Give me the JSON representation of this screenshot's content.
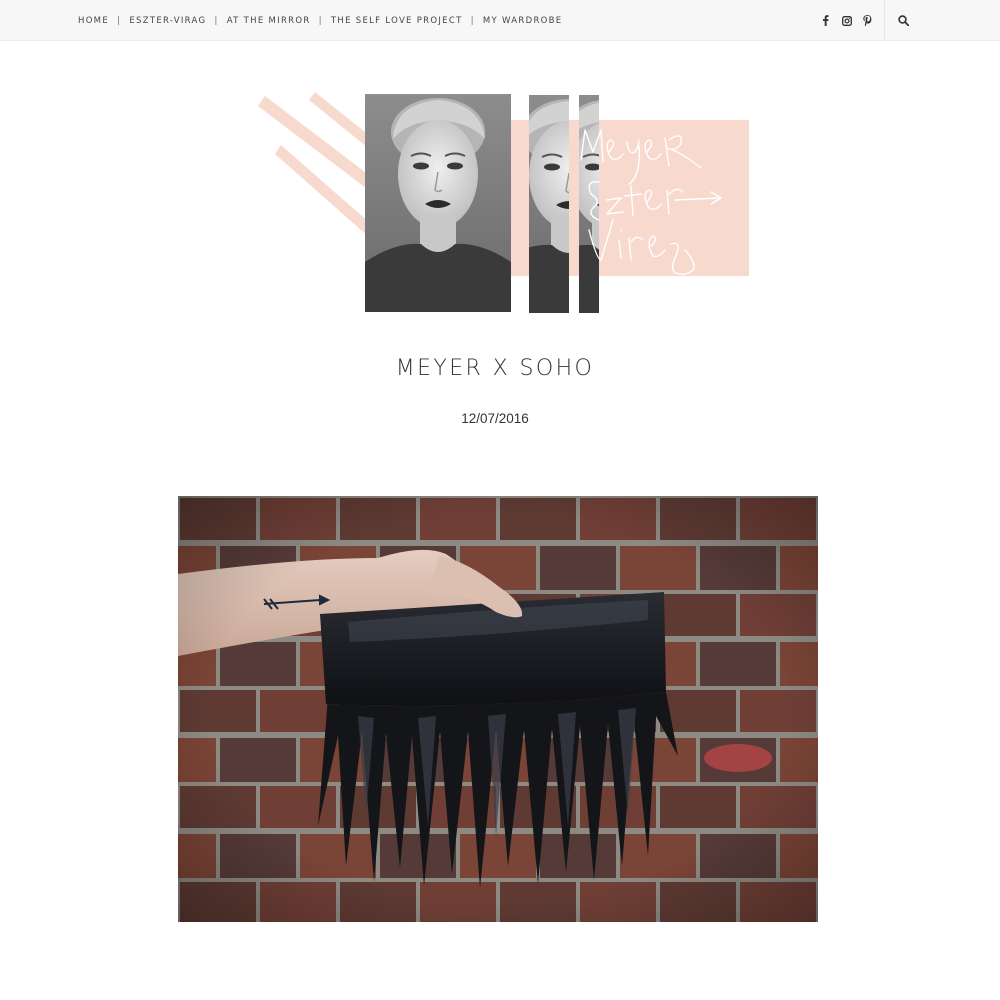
{
  "nav": {
    "items": [
      {
        "label": "HOME"
      },
      {
        "label": "ESZTER-VIRAG"
      },
      {
        "label": "AT THE MIRROR"
      },
      {
        "label": "THE SELF LOVE PROJECT"
      },
      {
        "label": "MY WARDROBE"
      }
    ],
    "separator": "|",
    "social_icons": [
      "facebook-icon",
      "instagram-icon",
      "pinterest-icon"
    ],
    "search_icon": "search-icon"
  },
  "logo": {
    "script_text": [
      "Meyer",
      "Eszter",
      "Virag"
    ],
    "accent_color": "#f8d9cd"
  },
  "post": {
    "title": "MEYER X SOHO",
    "date": "12/07/2016"
  },
  "colors": {
    "topbar_bg": "#f7f7f7",
    "text": "#333333",
    "pink": "#f8d9cd"
  }
}
